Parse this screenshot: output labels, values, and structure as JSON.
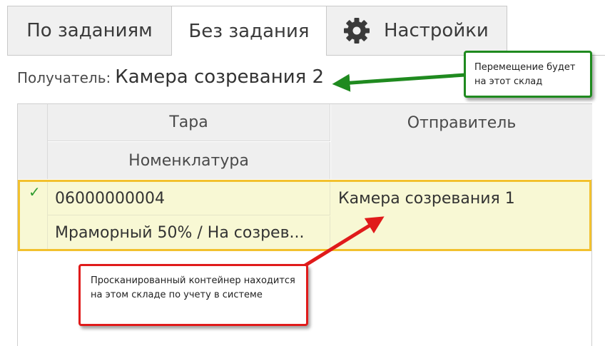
{
  "tabs": [
    {
      "label": "По заданиям"
    },
    {
      "label": "Без задания"
    },
    {
      "label": "Настройки",
      "icon": "gear-icon"
    }
  ],
  "recipient": {
    "label": "Получатель:",
    "value": "Камера созревания 2"
  },
  "grid": {
    "headers": {
      "tara": "Тара",
      "nomenclature": "Номенклатура",
      "sender": "Отправитель"
    },
    "rows": [
      {
        "check": "✓",
        "code": "06000000004",
        "nomenclature": "Мраморный 50% / На созрев...",
        "sender": "Камера созревания 1"
      }
    ]
  },
  "callouts": {
    "green": "Перемещение будет на этот склад",
    "red": "Просканированный контейнер находится на этом складе по учету в системе"
  },
  "colors": {
    "green": "#1f8a1f",
    "red": "#e01b1b",
    "row_highlight": "#f8f8d4",
    "row_border": "#f2c12e",
    "check": "#2e9b2e"
  }
}
